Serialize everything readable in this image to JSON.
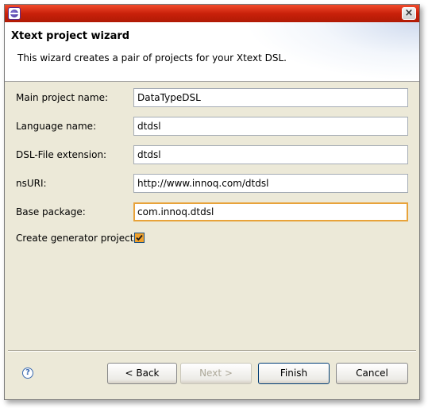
{
  "window": {
    "close_glyph": "×"
  },
  "banner": {
    "title": "Xtext project wizard",
    "description": "This wizard creates a pair of projects for your Xtext DSL."
  },
  "form": {
    "main_project_name": {
      "label": "Main project name:",
      "value": "DataTypeDSL"
    },
    "language_name": {
      "label": "Language name:",
      "value": "dtdsl"
    },
    "dsl_file_extension": {
      "label": "DSL-File extension:",
      "value": "dtdsl"
    },
    "ns_uri": {
      "label": "nsURI:",
      "value": "http://www.innoq.com/dtdsl"
    },
    "base_package": {
      "label": "Base package:",
      "value": "com.innoq.dtdsl"
    },
    "create_generator": {
      "label": "Create generator project:",
      "checked": true
    }
  },
  "buttons": {
    "help": "?",
    "back": "< Back",
    "next": "Next >",
    "finish": "Finish",
    "cancel": "Cancel"
  },
  "colors": {
    "titlebar": "#c9210a",
    "focus_border": "#e8a33a",
    "checkbox_fill": "#f0a12c"
  }
}
